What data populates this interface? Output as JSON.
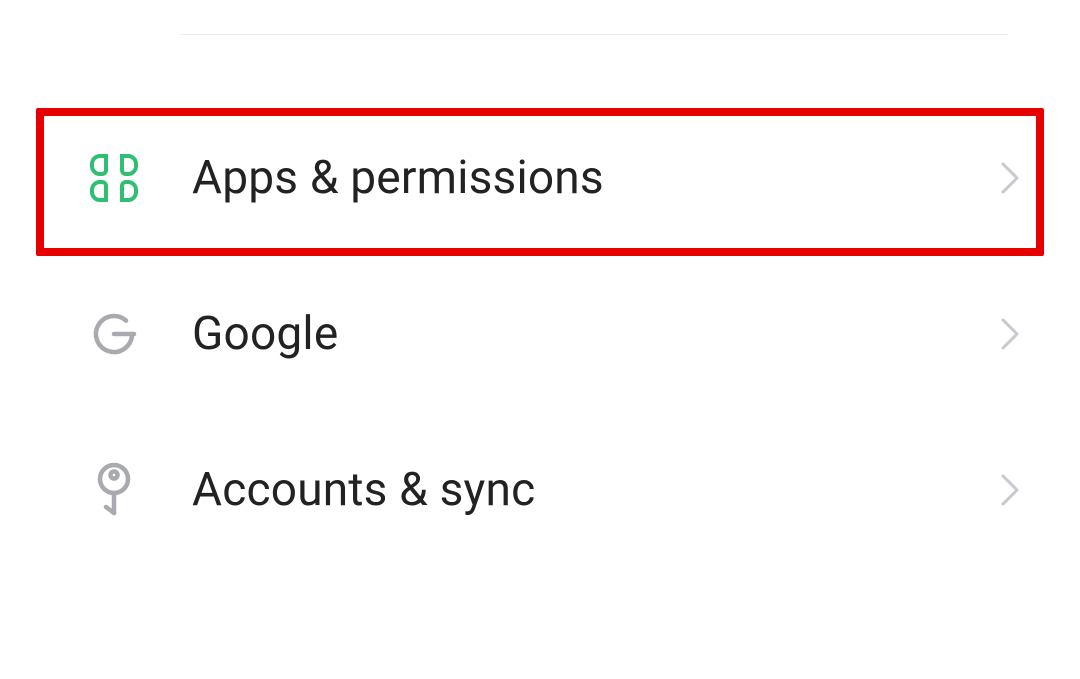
{
  "settings": {
    "items": [
      {
        "id": "apps-permissions",
        "label": "Apps & permissions",
        "icon": "apps-icon",
        "icon_color": "#2fbf71",
        "highlighted": true
      },
      {
        "id": "google",
        "label": "Google",
        "icon": "google-icon",
        "icon_color": "#a9a9b0",
        "highlighted": false
      },
      {
        "id": "accounts-sync",
        "label": "Accounts & sync",
        "icon": "key-icon",
        "icon_color": "#a9a9b0",
        "highlighted": false
      }
    ]
  },
  "colors": {
    "chevron": "#c8c8ce",
    "highlight_border": "#e60000",
    "divider": "#eaeaea",
    "text": "#222222"
  }
}
